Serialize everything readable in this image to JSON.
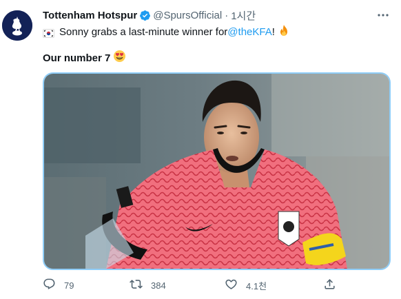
{
  "author": {
    "name": "Tottenham Hotspur",
    "handle": "@SpursOfficial",
    "separator": "·",
    "time": "1시간"
  },
  "tweet": {
    "text_before_mention": "Sonny grabs a last-minute winner for ",
    "mention": "@theKFA",
    "text_after_mention": "!",
    "line2": "Our number 7"
  },
  "actions": {
    "reply_count": "79",
    "retweet_count": "384",
    "like_count": "4.1천"
  },
  "icons": {
    "avatar": "tottenham-cockerel-logo",
    "verified": "verified-badge-icon",
    "more": "more-horizontal-icon",
    "flag": "south-korea-flag-icon",
    "fire": "fire-emoji",
    "heart_eyes": "heart-eyes-emoji",
    "reply": "reply-icon",
    "retweet": "retweet-icon",
    "like": "heart-icon",
    "share": "share-icon"
  },
  "colors": {
    "accent": "#1d9bf0",
    "text": "#0f1419",
    "muted": "#536471",
    "spurs_navy": "#132257"
  }
}
